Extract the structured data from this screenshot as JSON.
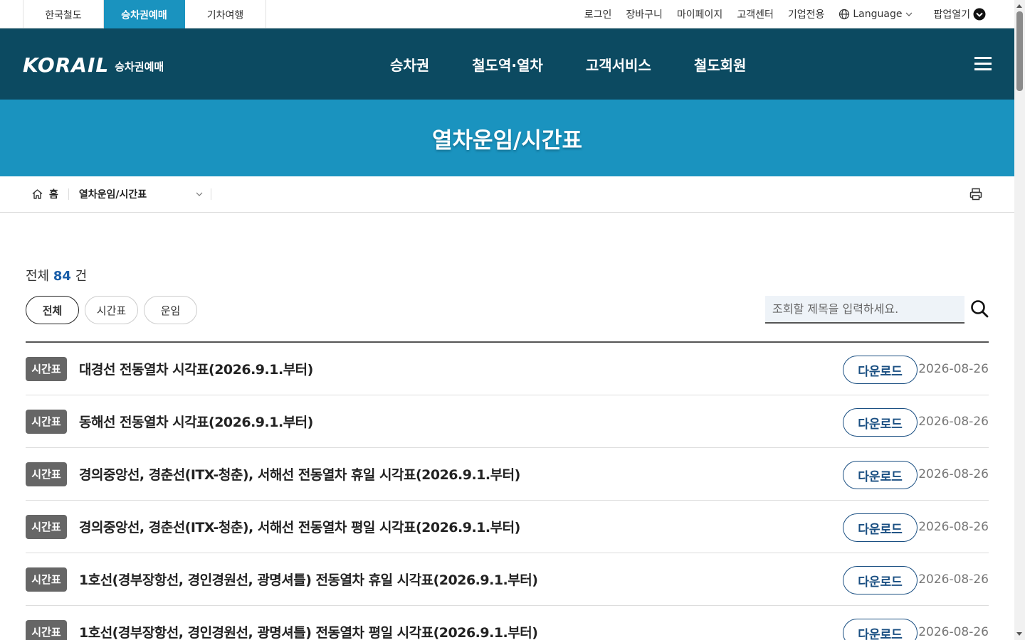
{
  "topbar": {
    "site_tabs": [
      {
        "label": "한국철도"
      },
      {
        "label": "승차권예매"
      },
      {
        "label": "기차여행"
      }
    ],
    "links": {
      "login": "로그인",
      "cart": "장바구니",
      "mypage": "마이페이지",
      "support": "고객센터",
      "corporate": "기업전용",
      "language": "Language",
      "popup": "팝업열기"
    }
  },
  "header": {
    "logo_word": "KORAIL",
    "logo_sub": "승차권예매",
    "nav": [
      "승차권",
      "철도역·열차",
      "고객서비스",
      "철도회원"
    ]
  },
  "banner": {
    "title": "열차운임/시간표"
  },
  "breadcrumb": {
    "home": "홈",
    "current": "열차운임/시간표"
  },
  "content": {
    "total_prefix": "전체",
    "total_count": "84",
    "total_suffix": "건",
    "filters": [
      "전체",
      "시간표",
      "운임"
    ],
    "search_placeholder": "조회할 제목을 입력하세요."
  },
  "items": [
    {
      "badge": "시간표",
      "title": "대경선 전동열차 시각표(2026.9.1.부터)",
      "action": "다운로드",
      "date": "2026-08-26"
    },
    {
      "badge": "시간표",
      "title": "동해선 전동열차 시각표(2026.9.1.부터)",
      "action": "다운로드",
      "date": "2026-08-26"
    },
    {
      "badge": "시간표",
      "title": "경의중앙선, 경춘선(ITX-청춘), 서해선 전동열차 휴일 시각표(2026.9.1.부터)",
      "action": "다운로드",
      "date": "2026-08-26"
    },
    {
      "badge": "시간표",
      "title": "경의중앙선, 경춘선(ITX-청춘), 서해선 전동열차 평일 시각표(2026.9.1.부터)",
      "action": "다운로드",
      "date": "2026-08-26"
    },
    {
      "badge": "시간표",
      "title": "1호선(경부장항선, 경인경원선, 광명셔틀) 전동열차 휴일 시각표(2026.9.1.부터)",
      "action": "다운로드",
      "date": "2026-08-26"
    },
    {
      "badge": "시간표",
      "title": "1호선(경부장항선, 경인경원선, 광명셔틀) 전동열차 평일 시각표(2026.9.1.부터)",
      "action": "다운로드",
      "date": "2026-08-26"
    }
  ],
  "colors": {
    "header": "#0c4a61",
    "banner": "#1a93bf",
    "accent": "#1a4f82"
  }
}
